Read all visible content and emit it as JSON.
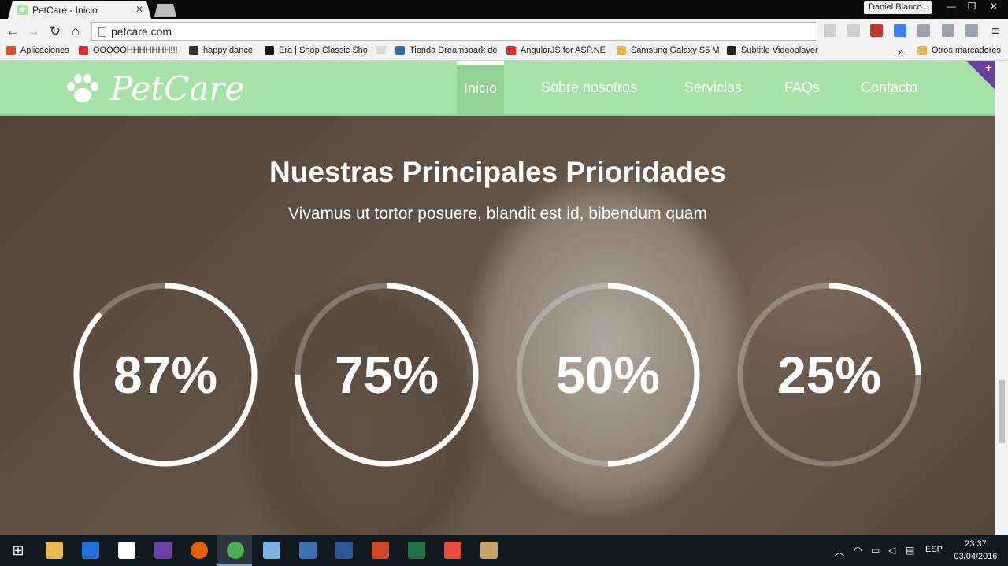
{
  "browser": {
    "tab_title": "PetCare - Inicio",
    "tab_close": "✕",
    "profile_name": "Daniel Blanco...",
    "url": "petcare.com",
    "window_controls": [
      "—",
      "❐",
      "✕"
    ],
    "bookmarks": [
      {
        "label": "Aplicaciones",
        "icon": "apps-grid-icon",
        "color": "#e44d26"
      },
      {
        "label": "OOOOOHHHHHHH!!!",
        "icon": "youtube-icon",
        "color": "#e52d27"
      },
      {
        "label": "happy dance",
        "icon": "video-icon",
        "color": "#333333"
      },
      {
        "label": "Era | Shop Classic Sho",
        "icon": "shop-icon",
        "color": "#111111"
      },
      {
        "label": "",
        "icon": "page-icon",
        "color": "#cccccc"
      },
      {
        "label": "Tienda Dreamspark de",
        "icon": "dreamspark-icon",
        "color": "#2b6cb0"
      },
      {
        "label": "AngularJS for ASP.NE",
        "icon": "youtube-icon",
        "color": "#e52d27"
      },
      {
        "label": "Samsung Galaxy S5 M",
        "icon": "folder-icon",
        "color": "#e8b84a"
      },
      {
        "label": "Subtitle Videoplayer",
        "icon": "app-icon",
        "color": "#222222"
      }
    ],
    "bookmarks_overflow": "»",
    "other_bookmarks": "Otros marcadores"
  },
  "site": {
    "logo_text": "PetCare",
    "nav": [
      {
        "label": "Inicio",
        "active": true
      },
      {
        "label": "Sobre nosotros",
        "active": false
      },
      {
        "label": "Servicios",
        "active": false
      },
      {
        "label": "FAQs",
        "active": false
      },
      {
        "label": "Contacto",
        "active": false
      }
    ],
    "corner_plus": "+",
    "hero": {
      "title": "Nuestras Principales Prioridades",
      "subtitle": "Vivamus ut tortor posuere, blandit est id, bibendum quam"
    },
    "stats": [
      {
        "label": "87%",
        "value": 0.87
      },
      {
        "label": "75%",
        "value": 0.75
      },
      {
        "label": "50%",
        "value": 0.5
      },
      {
        "label": "25%",
        "value": 0.25
      }
    ],
    "colors": {
      "nav_bg": "#a6e2a6",
      "ring": "#ffffff",
      "accent_purple": "#6b3fa0"
    }
  },
  "taskbar": {
    "apps": [
      "windows-start-icon",
      "file-explorer-icon",
      "edge-icon",
      "store-icon",
      "visual-studio-icon",
      "firefox-icon",
      "chrome-icon",
      "box-app-icon",
      "remote-desktop-icon",
      "word-icon",
      "powerpoint-icon",
      "excel-icon",
      "popcorn-icon",
      "media-icon"
    ],
    "language": "ESP",
    "time": "23:37",
    "date": "03/04/2016"
  }
}
